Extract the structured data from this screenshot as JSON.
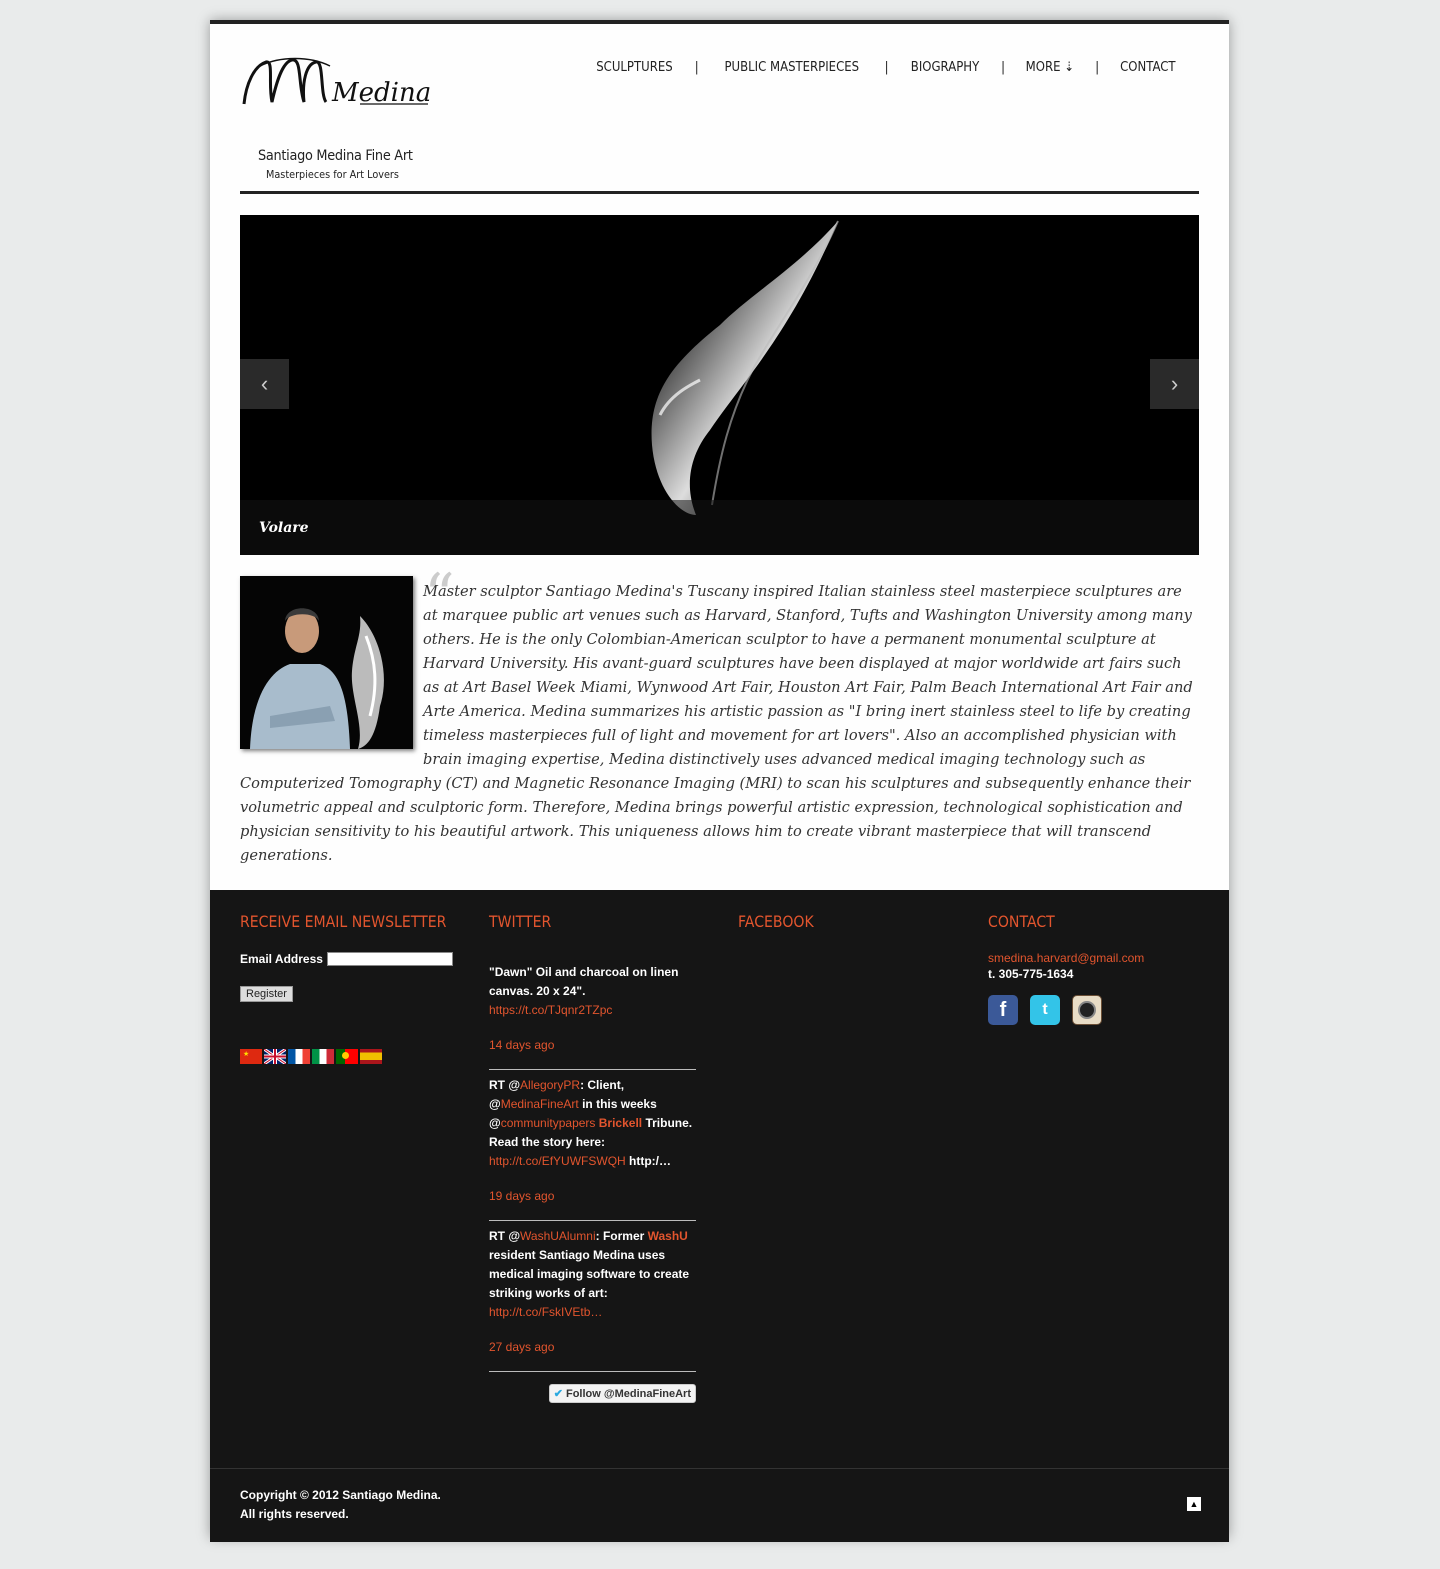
{
  "header": {
    "logo_text": "Medina",
    "site_name": "Santiago Medina Fine Art",
    "tagline": "Masterpieces for Art Lovers",
    "nav": [
      {
        "label": "SCULPTURES"
      },
      {
        "label": "PUBLIC MASTERPIECES"
      },
      {
        "label": "BIOGRAPHY"
      },
      {
        "label": "MORE ⇣"
      },
      {
        "label": "CONTACT"
      }
    ],
    "separator": "|"
  },
  "slider": {
    "caption": "Volare",
    "prev_icon": "chevron-left-icon",
    "next_icon": "chevron-right-icon"
  },
  "bio": {
    "quote_mark": "“",
    "text": "Master sculptor Santiago Medina's Tuscany inspired Italian stainless steel masterpiece sculptures are at marquee public art venues such as Harvard, Stanford, Tufts and Washington University among many others. He is the only Colombian-American sculptor to have a permanent monumental sculpture at Harvard University. His avant-guard sculptures have been displayed at major worldwide art fairs such as at Art Basel Week Miami, Wynwood Art Fair, Houston Art Fair, Palm Beach International Art Fair and Arte America. Medina summarizes his artistic passion as \"I bring inert stainless steel to life by creating timeless masterpieces full of light and movement for art lovers\". Also an accomplished physician with brain imaging expertise, Medina distinctively uses advanced medical imaging technology such as Computerized Tomography (CT) and Magnetic Resonance Imaging (MRI) to scan his sculptures and subsequently enhance their volumetric appeal and sculptoric form. Therefore, Medina brings powerful artistic expression, technological sophistication and physician sensitivity to his beautiful artwork. This uniqueness allows him to create vibrant masterpiece that will transcend generations."
  },
  "footer": {
    "newsletter": {
      "heading": "RECEIVE EMAIL NEWSLETTER",
      "email_label": "Email Address",
      "email_value": "",
      "register_label": "Register"
    },
    "twitter": {
      "heading": "TWITTER",
      "tweets": [
        {
          "t1": "\"Dawn\" Oil and charcoal on linen canvas. 20 x 24\".",
          "link": "https://t.co/TJqnr2TZpc",
          "time": "14 days ago"
        },
        {
          "p1": "RT @",
          "h1": "AllegoryPR",
          "p2": ": Client, @",
          "h2": "MedinaFineArt",
          "p3": " in this weeks @",
          "h3": "communitypapers",
          "p4": "  ",
          "h4": "Brickell",
          "p5": " Tribune. Read the story here: ",
          "link": "http://t.co/EfYUWFSWQH",
          "p6": " http:/…",
          "time": "19 days ago"
        },
        {
          "p1": "RT @",
          "h1": "WashUAlumni",
          "p2": ": Former  ",
          "h2": "WashU",
          "p3": " resident Santiago Medina uses medical imaging software to create striking works of art: ",
          "link": "http://t.co/FskIVEtb…",
          "time": "27 days ago"
        }
      ],
      "follow_label": "Follow @MedinaFineArt"
    },
    "facebook": {
      "heading": "FACEBOOK"
    },
    "contact": {
      "heading": "CONTACT",
      "email": "smedina.harvard@gmail.com",
      "phone": "t. 305-775-1634",
      "social": [
        "facebook-icon",
        "twitter-icon",
        "instagram-icon"
      ]
    },
    "copyright_line1": "Copyright © 2012 Santiago Medina.",
    "copyright_line2": "All rights reserved.",
    "back_top": "▲"
  },
  "colors": {
    "accent": "#e2552e",
    "footer_bg": "#151515",
    "page_bg": "#e9ebeb"
  }
}
